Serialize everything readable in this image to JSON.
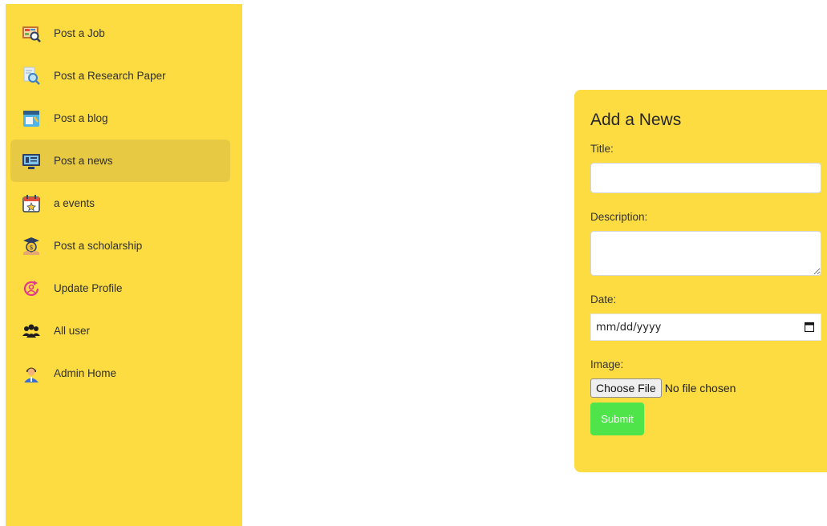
{
  "sidebar": {
    "items": [
      {
        "label": "Post a Job",
        "icon": "job-board-icon"
      },
      {
        "label": "Post a Research Paper",
        "icon": "research-magnifier-icon"
      },
      {
        "label": "Post a blog",
        "icon": "blog-page-icon"
      },
      {
        "label": "Post a news",
        "icon": "news-monitor-icon",
        "active": true
      },
      {
        "label": "a events",
        "icon": "calendar-icon"
      },
      {
        "label": "Post a scholarship",
        "icon": "scholarship-money-icon"
      },
      {
        "label": "Update Profile",
        "icon": "profile-refresh-icon"
      },
      {
        "label": "All user",
        "icon": "users-group-icon"
      },
      {
        "label": "Admin Home",
        "icon": "admin-user-icon"
      }
    ]
  },
  "form": {
    "title": "Add a News",
    "title_label": "Title:",
    "description_label": "Description:",
    "date_label": "Date:",
    "date_placeholder": "mm/dd/yyyy",
    "image_label": "Image:",
    "choose_file_label": "Choose File",
    "no_file_text": "No file chosen",
    "submit_label": "Submit"
  },
  "colors": {
    "panel_yellow": "#fcdc41",
    "active_item": "#e8c944",
    "submit_green": "#4ee44a"
  }
}
